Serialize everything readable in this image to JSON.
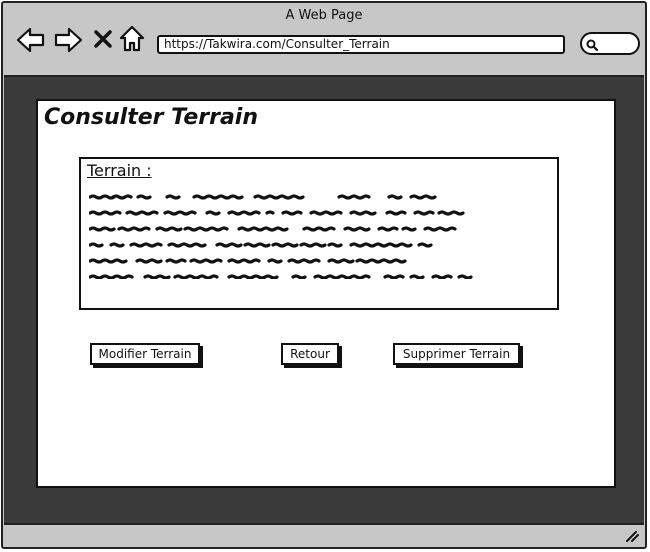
{
  "browser": {
    "title": "A Web Page",
    "url": "https://Takwira.com/Consulter_Terrain"
  },
  "page": {
    "title": "Consulter Terrain",
    "panel_label": "Terrain :"
  },
  "buttons": {
    "modify": "Modifier Terrain",
    "back": "Retour",
    "delete": "Supprimer Terrain"
  },
  "icons": [
    "back-arrow-icon",
    "forward-arrow-icon",
    "close-icon",
    "home-icon",
    "search-icon",
    "resize-handle-icon"
  ]
}
